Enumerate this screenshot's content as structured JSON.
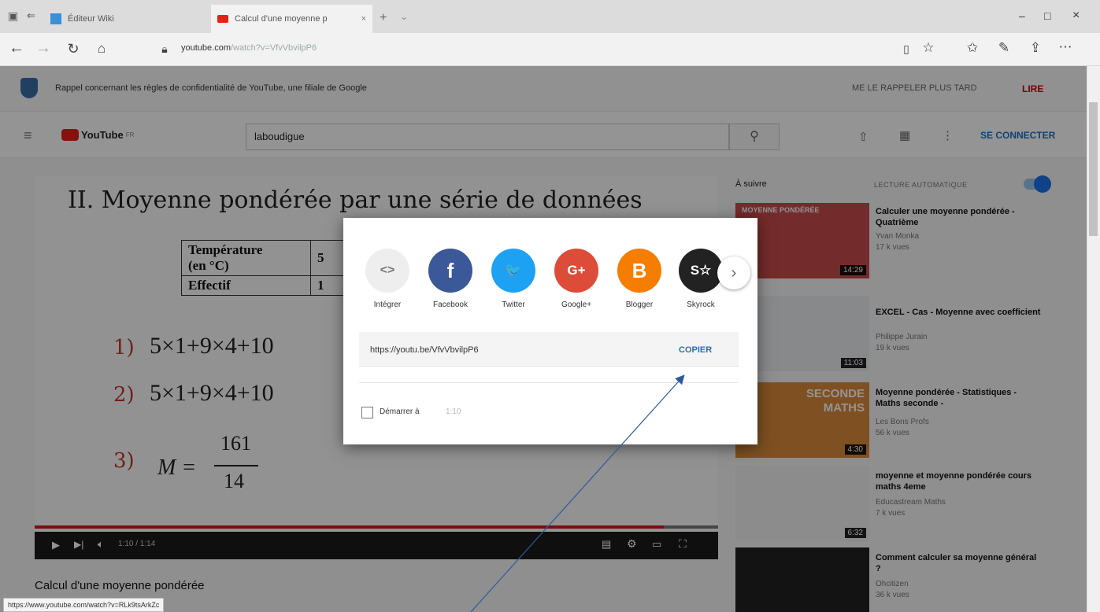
{
  "browser": {
    "tabs": [
      {
        "label": "Éditeur Wiki"
      },
      {
        "label": "Calcul d'une moyenne p"
      }
    ],
    "new_tab": "+",
    "url_host": "youtube.com",
    "url_path": "/watch?v=VfvVbvilpP6",
    "window_controls": [
      "–",
      "□",
      "×"
    ]
  },
  "privacy_notice": {
    "text": "Rappel concernant les règles de confidentialité de YouTube, une filiale de Google",
    "later": "ME LE RAPPELER PLUS TARD",
    "read": "LIRE"
  },
  "youtube": {
    "logo": "YouTube",
    "logo_suffix": "FR",
    "search_value": "laboudigue",
    "sign_in": "SE CONNECTER"
  },
  "video": {
    "heading": "II. Moyenne pondérée par une série de données",
    "table": {
      "row1_label": "Température",
      "row1_label_2": "(en °C)",
      "row1_value": "5",
      "row2_label": "Effectif",
      "row2_value": "1"
    },
    "step1_num": "1)",
    "step1_expr": "5×1+9×4+10",
    "step2_num": "2)",
    "step2_expr": "5×1+9×4+10",
    "step3_num": "3)",
    "step3_lhs": "M =",
    "step3_numerator": "161",
    "step3_denominator": "14",
    "progress_fraction": 0.92,
    "time": "1:10 / 1:14",
    "title": "Calcul d'une moyenne pondérée"
  },
  "status_bar_url": "https://www.youtube.com/watch?v=RLk9tsArkZc",
  "sidebar": {
    "next_label": "À suivre",
    "autoplay_label": "LECTURE AUTOMATIQUE",
    "autoplay_on": true,
    "items": [
      {
        "thumb_text": "MOYENNE PONDÉRÉE",
        "duration": "14:29",
        "title": "Calculer une moyenne pondérée - Quatrième",
        "channel": "Yvan Monka",
        "views": "17 k vues",
        "thumb_color": "#c94a4a"
      },
      {
        "thumb_text": "",
        "duration": "11:03",
        "title": "EXCEL - Cas - Moyenne avec coefficient",
        "channel": "Philippe Jurain",
        "views": "19 k vues",
        "thumb_color": "#e9ecef"
      },
      {
        "thumb_text": "SECONDE MATHS",
        "duration": "4:30",
        "title": "Moyenne pondérée - Statistiques - Maths seconde -",
        "channel": "Les Bons Profs",
        "views": "56 k vues",
        "thumb_color": "#d98a3c"
      },
      {
        "thumb_text": "",
        "duration": "6:32",
        "title": "moyenne et moyenne pondérée cours maths 4eme",
        "channel": "Educastream Maths",
        "views": "7 k vues",
        "thumb_color": "#f2f2f2"
      },
      {
        "thumb_text": "",
        "duration": "",
        "title": "Comment calculer sa moyenne général ?",
        "channel": "Ohcitizen",
        "views": "36 k vues",
        "thumb_color": "#222222"
      }
    ]
  },
  "share_modal": {
    "buttons": [
      {
        "label": "Intégrer",
        "glyph": "<>",
        "color": "#eeeeee",
        "icon": "embed-icon"
      },
      {
        "label": "Facebook",
        "glyph": "f",
        "color": "#3b5998",
        "icon": "facebook-icon"
      },
      {
        "label": "Twitter",
        "glyph": "🐦",
        "color": "#1da1f2",
        "icon": "twitter-icon"
      },
      {
        "label": "Google+",
        "glyph": "G+",
        "color": "#dd4b39",
        "icon": "googleplus-icon"
      },
      {
        "label": "Blogger",
        "glyph": "B",
        "color": "#f57d00",
        "icon": "blogger-icon"
      },
      {
        "label": "Skyrock",
        "glyph": "S☆",
        "color": "#222222",
        "icon": "skyrock-icon"
      }
    ],
    "link": "https://youtu.be/VfvVbvilpP6",
    "copy": "COPIER",
    "start_label": "Démarrer à",
    "start_time": "1:10"
  }
}
